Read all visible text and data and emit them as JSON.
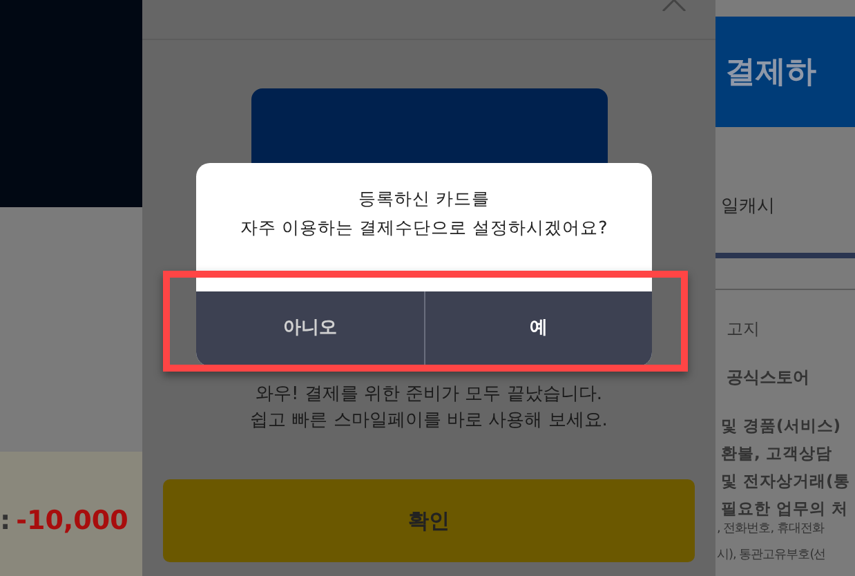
{
  "background_left": {
    "amount_label": ":",
    "amount": "-10,000"
  },
  "background_right": {
    "pay_button": "결제하",
    "cash_tab": "일캐시",
    "notice": "고지",
    "store": "공식스토어",
    "terms_lines": [
      "및 경품(서비스)",
      "환불, 고객상담",
      "및 전자상거래(통",
      "필요한 업무의 처"
    ],
    "info_lines": [
      ", 전화번호, 휴대전화",
      "시), 통관고유부호(선"
    ]
  },
  "sheet": {
    "message_lines": [
      "와우! 결제를 위한 준비가 모두 끝났습니다.",
      "쉽고 빠른 스마일페이를 바로 사용해 보세요."
    ],
    "confirm_button": "확인"
  },
  "dialog": {
    "message_lines": [
      "등록하신 카드를",
      "자주 이용하는 결제수단으로 설정하시겠어요?"
    ],
    "buttons": [
      {
        "label": "아니오",
        "kind": "secondary"
      },
      {
        "label": "예",
        "kind": "primary"
      }
    ],
    "highlighted": true
  }
}
